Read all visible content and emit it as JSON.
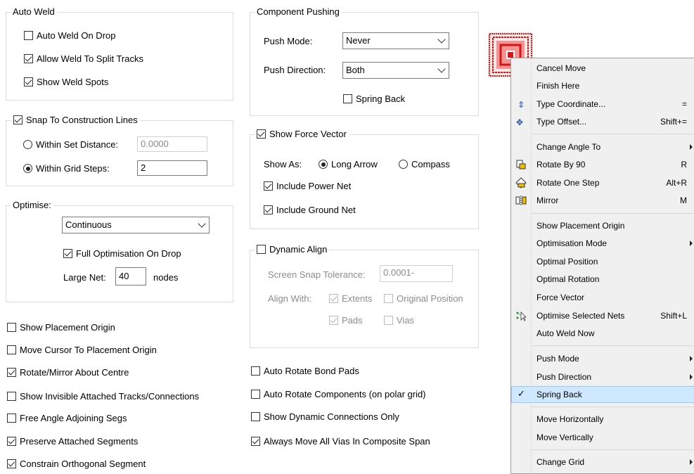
{
  "auto_weld": {
    "title": "Auto Weld",
    "items": [
      {
        "label": "Auto Weld On Drop",
        "checked": false
      },
      {
        "label": "Allow Weld To Split Tracks",
        "checked": true
      },
      {
        "label": "Show Weld Spots",
        "checked": true
      }
    ]
  },
  "snap": {
    "title": "Snap To Construction Lines",
    "checked": true,
    "within_set_distance": {
      "label": "Within Set Distance:",
      "value": "0.0000",
      "selected": false
    },
    "within_grid_steps": {
      "label": "Within Grid Steps:",
      "value": "2",
      "selected": true
    }
  },
  "optimise": {
    "title": "Optimise:",
    "mode": "Continuous",
    "full_opt_label": "Full Optimisation On Drop",
    "full_opt_checked": true,
    "large_net_label": "Large Net:",
    "large_net_value": "40",
    "nodes_label": "nodes"
  },
  "left_options": [
    {
      "label": "Show Placement Origin",
      "checked": false
    },
    {
      "label": "Move Cursor To Placement Origin",
      "checked": false
    },
    {
      "label": "Rotate/Mirror About Centre",
      "checked": true
    },
    {
      "label": "Show Invisible Attached Tracks/Connections",
      "checked": false
    },
    {
      "label": "Free Angle Adjoining Segs",
      "checked": false
    },
    {
      "label": "Preserve Attached Segments",
      "checked": true
    },
    {
      "label": "Constrain Orthogonal Segment",
      "checked": true
    }
  ],
  "component_pushing": {
    "title": "Component Pushing",
    "push_mode_label": "Push Mode:",
    "push_mode_value": "Never",
    "push_direction_label": "Push Direction:",
    "push_direction_value": "Both",
    "spring_back_label": "Spring Back",
    "spring_back_checked": false
  },
  "force_vector": {
    "title": "Show Force Vector",
    "checked": true,
    "show_as_label": "Show As:",
    "long_arrow_label": "Long Arrow",
    "compass_label": "Compass",
    "include_power_label": "Include Power Net",
    "include_ground_label": "Include Ground Net"
  },
  "dynamic_align": {
    "title": "Dynamic Align",
    "checked": false,
    "tolerance_label": "Screen Snap Tolerance:",
    "tolerance_value": "0.0001-",
    "align_with_label": "Align With:",
    "extents_label": "Extents",
    "original_position_label": "Original Position",
    "pads_label": "Pads",
    "vias_label": "Vias"
  },
  "mid_options": [
    {
      "label": "Auto Rotate Bond Pads",
      "checked": false
    },
    {
      "label": "Auto Rotate Components (on polar grid)",
      "checked": false
    },
    {
      "label": "Show Dynamic Connections Only",
      "checked": false
    },
    {
      "label": "Always Move All Vias In Composite Span",
      "checked": true
    }
  ],
  "context_menu": {
    "items": [
      {
        "label": "Cancel Move",
        "shortcut": ""
      },
      {
        "label": "Finish Here",
        "shortcut": ""
      },
      {
        "label": "Type Coordinate...",
        "shortcut": "="
      },
      {
        "label": "Type Offset...",
        "shortcut": "Shift+="
      },
      {
        "label": "Change Angle To",
        "shortcut": ""
      },
      {
        "label": "Rotate By 90",
        "shortcut": "R"
      },
      {
        "label": "Rotate One Step",
        "shortcut": "Alt+R"
      },
      {
        "label": "Mirror",
        "shortcut": "M"
      },
      {
        "label": "Show Placement Origin",
        "shortcut": ""
      },
      {
        "label": "Optimisation Mode",
        "shortcut": ""
      },
      {
        "label": "Optimal Position",
        "shortcut": ""
      },
      {
        "label": "Optimal Rotation",
        "shortcut": ""
      },
      {
        "label": "Force Vector",
        "shortcut": ""
      },
      {
        "label": "Optimise Selected Nets",
        "shortcut": "Shift+L"
      },
      {
        "label": "Auto Weld Now",
        "shortcut": ""
      },
      {
        "label": "Push Mode",
        "shortcut": ""
      },
      {
        "label": "Push Direction",
        "shortcut": ""
      },
      {
        "label": "Spring Back",
        "shortcut": ""
      },
      {
        "label": "Move Horizontally",
        "shortcut": ""
      },
      {
        "label": "Move Vertically",
        "shortcut": ""
      },
      {
        "label": "Change Grid",
        "shortcut": ""
      }
    ]
  },
  "colors": {
    "accent_red": "#d01818",
    "menu_highlight": "#cde8ff"
  }
}
